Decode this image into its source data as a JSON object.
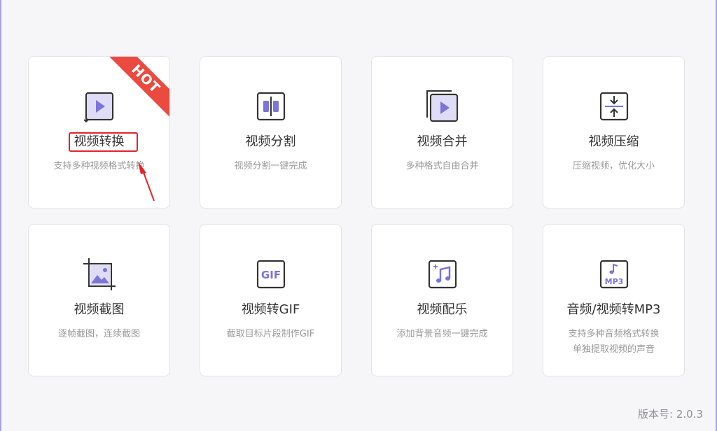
{
  "cards": [
    {
      "title": "视频转换",
      "desc": [
        "支持多种视频格式转换"
      ],
      "icon": "video-convert-icon",
      "badge": "HOT"
    },
    {
      "title": "视频分割",
      "desc": [
        "视频分割一键完成"
      ],
      "icon": "video-split-icon"
    },
    {
      "title": "视频合并",
      "desc": [
        "多种格式自由合并"
      ],
      "icon": "video-merge-icon"
    },
    {
      "title": "视频压缩",
      "desc": [
        "压缩视频，优化大小"
      ],
      "icon": "video-compress-icon"
    },
    {
      "title": "视频截图",
      "desc": [
        "逐帧截图，连续截图"
      ],
      "icon": "video-screenshot-icon"
    },
    {
      "title": "视频转GIF",
      "desc": [
        "截取目标片段制作GIF"
      ],
      "icon": "video-to-gif-icon",
      "icon_text": "GIF"
    },
    {
      "title": "视频配乐",
      "desc": [
        "添加背景音频一键完成"
      ],
      "icon": "video-music-icon"
    },
    {
      "title": "音频/视频转MP3",
      "desc": [
        "支持多种音频格式转换",
        "单独提取视频的声音"
      ],
      "icon": "audio-video-to-mp3-icon",
      "icon_text": "MP3"
    }
  ],
  "version": "版本号: 2.0.3",
  "colors": {
    "accent": "#7b74d9",
    "accent_light": "#dedcf7",
    "icon_stroke": "#333333",
    "hot_badge": "#ea4a3f",
    "highlight": "#e2242a",
    "background": "#f6f6f9"
  }
}
